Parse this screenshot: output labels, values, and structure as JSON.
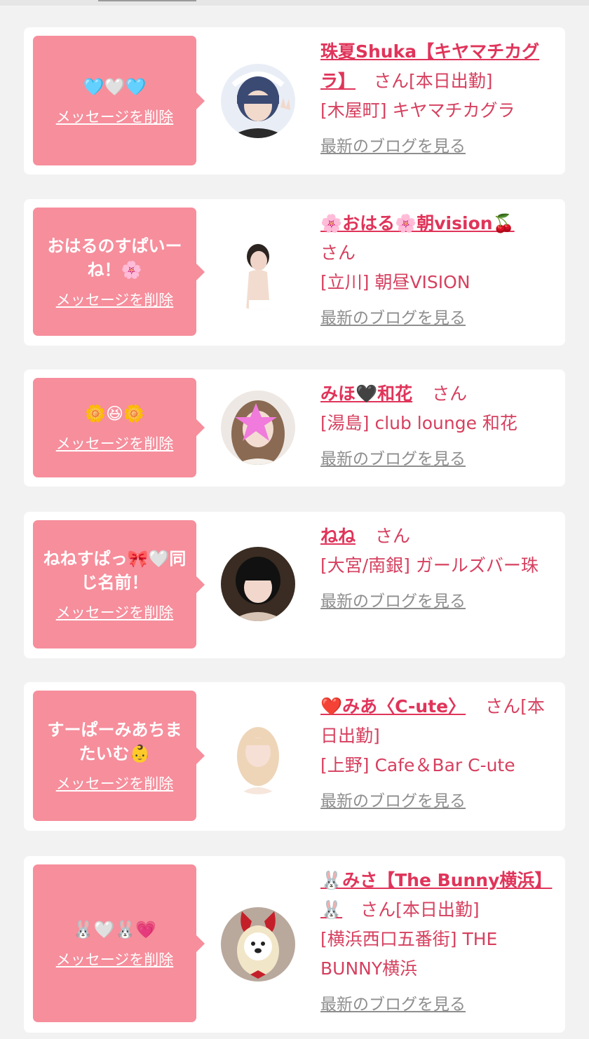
{
  "delete_label": "メッセージを削除",
  "blog_label": "最新のブログを見る",
  "san_label": "さん",
  "colors": {
    "bubble": "#f68e9c",
    "name": "#e0345a",
    "text": "#d6405f",
    "link_gray": "#8e8e8e",
    "bg": "#f2f2f2"
  },
  "cards": [
    {
      "message": "🩵🤍🩵",
      "name": "珠夏Shuka【キヤマチカグラ】",
      "suffix": "[本日出勤]",
      "shop": "[木屋町] キヤマチカグラ",
      "avatar_icon": "dark-hair-girl-peace-sign"
    },
    {
      "message": "おはるのすぱいーね！🌸",
      "name": "🌸おはる🌸朝vision🍒",
      "suffix": "",
      "shop": "[立川] 朝昼VISION",
      "avatar_icon": "girl-blurred-face"
    },
    {
      "message": "🌼😆🌼",
      "name": "みほ🖤和花",
      "suffix": "",
      "shop": "[湯島] club lounge 和花",
      "avatar_icon": "girl-star-over-face"
    },
    {
      "message": "ねねすぱっ🎀🤍同じ名前！",
      "name": "ねね",
      "suffix": "",
      "shop": "[大宮/南銀] ガールズバー珠",
      "avatar_icon": "black-hair-girl"
    },
    {
      "message": "すーぱーみあちまたいむ👶",
      "name": "❤️みあ〈C-ute〉",
      "suffix": "[本日出勤]",
      "shop": "[上野] Cafe＆Bar C-ute",
      "avatar_icon": "blonde-girl"
    },
    {
      "message": "🐰🤍🐰💗",
      "name": "🐰みさ【The Bunny横浜】🐰",
      "suffix": "[本日出勤]",
      "shop": "[横浜西口五番街] THE BUNNY横浜",
      "avatar_icon": "girl-bunny-ears-bear-mask"
    }
  ]
}
